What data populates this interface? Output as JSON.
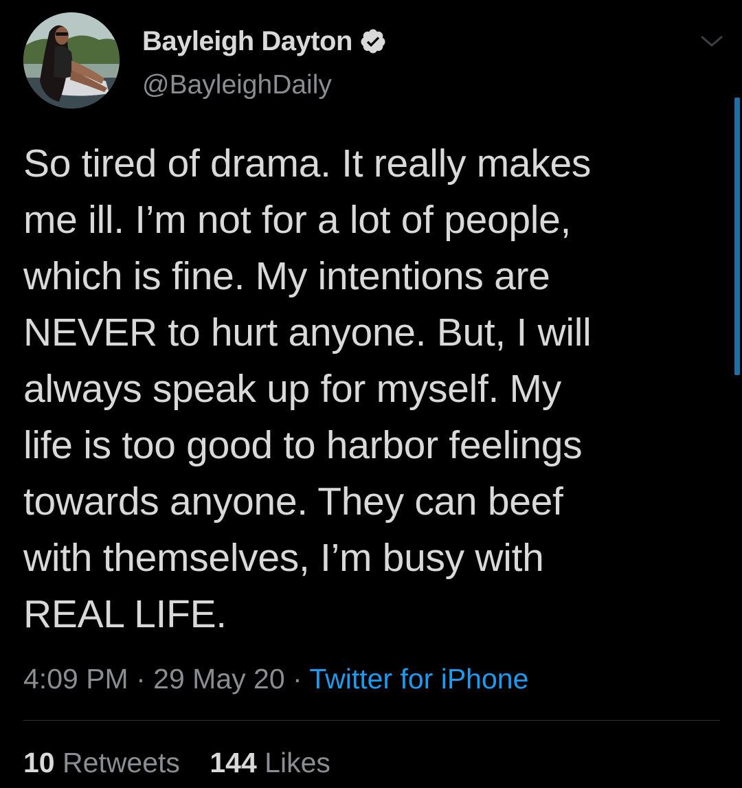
{
  "author": {
    "display_name": "Bayleigh Dayton",
    "handle": "@BayleighDaily",
    "verified": true,
    "avatar": "profile-photo"
  },
  "tweet": {
    "text": "So tired of drama. It really makes\nme ill. I’m not for a lot of people,\nwhich is fine. My intentions are\nNEVER to hurt anyone. But, I will\nalways speak up for myself. My\nlife is too good to harbor feelings\ntowards anyone. They can beef\nwith themselves, I’m busy with\nREAL LIFE.",
    "time": "4:09 PM",
    "separator": "·",
    "date": "29 May 20",
    "source": "Twitter for iPhone"
  },
  "stats": {
    "retweets_count": "10",
    "retweets_label": "Retweets",
    "likes_count": "144",
    "likes_label": "Likes"
  },
  "icons": {
    "menu": "chevron-down-icon",
    "verified": "verified-badge-icon"
  },
  "colors": {
    "background": "#000000",
    "text_primary": "#d9d9d9",
    "text_secondary": "#8a8d91",
    "link": "#1d9bf0",
    "divider": "#2f3336",
    "scroll_indicator": "#1d6fa5"
  }
}
